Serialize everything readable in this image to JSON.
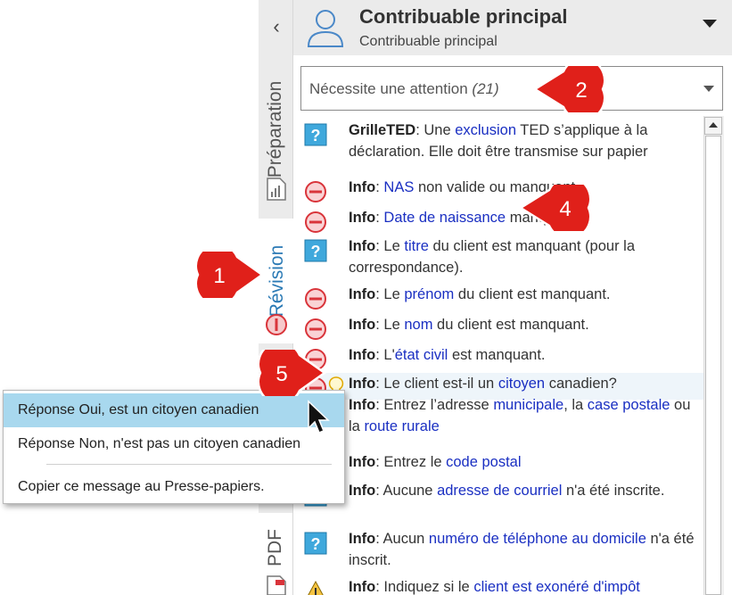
{
  "sidebar": {
    "collapse_glyph": "‹",
    "tabs": [
      {
        "label": "Préparation",
        "icon": "chart-doc-icon"
      },
      {
        "label": "Révision",
        "icon": "no-entry-icon",
        "active": true
      },
      {
        "label": "PDF",
        "icon": "pdf-doc-icon"
      }
    ]
  },
  "header": {
    "title": "Contribuable principal",
    "subtitle": "Contribuable principal",
    "icon": "user-icon"
  },
  "filter": {
    "label": "Nécessite une attention",
    "count": "(21)"
  },
  "messages": [
    {
      "icon": "question-icon",
      "parts": [
        {
          "t": "GrilleTED",
          "b": true
        },
        {
          "t": ": Une "
        },
        {
          "t": "exclusion",
          "l": true
        },
        {
          "t": " TED s’applique à la déclaration. Elle doit être transmise sur papier"
        }
      ]
    },
    {
      "icon": "no-entry-icon",
      "parts": [
        {
          "t": "Info",
          "b": true
        },
        {
          "t": ": "
        },
        {
          "t": "NAS",
          "l": true
        },
        {
          "t": " non valide ou manquant."
        }
      ]
    },
    {
      "icon": "no-entry-icon",
      "parts": [
        {
          "t": "Info",
          "b": true
        },
        {
          "t": ": "
        },
        {
          "t": "Date de naissance",
          "l": true
        },
        {
          "t": " manquante."
        }
      ]
    },
    {
      "icon": "question-icon",
      "parts": [
        {
          "t": "Info",
          "b": true
        },
        {
          "t": ": Le "
        },
        {
          "t": "titre",
          "l": true
        },
        {
          "t": " du client est manquant (pour la correspondance)."
        }
      ]
    },
    {
      "icon": "no-entry-icon",
      "parts": [
        {
          "t": "Info",
          "b": true
        },
        {
          "t": ": Le "
        },
        {
          "t": "prénom",
          "l": true
        },
        {
          "t": " du client est manquant."
        }
      ]
    },
    {
      "icon": "no-entry-icon",
      "parts": [
        {
          "t": "Info",
          "b": true
        },
        {
          "t": ": Le "
        },
        {
          "t": "nom",
          "l": true
        },
        {
          "t": " du client est manquant."
        }
      ]
    },
    {
      "icon": "no-entry-icon",
      "parts": [
        {
          "t": "Info",
          "b": true
        },
        {
          "t": ": L'"
        },
        {
          "t": "état civil",
          "l": true
        },
        {
          "t": " est manquant."
        }
      ]
    },
    {
      "icon": "no-entry-icon",
      "hint": "lightbulb-icon",
      "parts": [
        {
          "t": "Info",
          "b": true
        },
        {
          "t": ": Le client est-il un "
        },
        {
          "t": "citoyen",
          "l": true
        },
        {
          "t": " canadien?"
        }
      ]
    },
    {
      "icon": "question-icon",
      "parts": [
        {
          "t": "Info",
          "b": true
        },
        {
          "t": ": Entrez l’adresse "
        },
        {
          "t": "municipale",
          "l": true
        },
        {
          "t": ", la "
        },
        {
          "t": "case postale",
          "l": true
        },
        {
          "t": " ou la "
        },
        {
          "t": "route rurale",
          "l": true
        }
      ]
    },
    {
      "icon": "question-icon",
      "parts": [
        {
          "t": "Info",
          "b": true
        },
        {
          "t": ": Entrez le "
        },
        {
          "t": "code postal",
          "l": true
        }
      ]
    },
    {
      "icon": "question-icon",
      "parts": [
        {
          "t": "Info",
          "b": true
        },
        {
          "t": ": Aucune "
        },
        {
          "t": "adresse de courriel",
          "l": true
        },
        {
          "t": " n'a été inscrite."
        }
      ]
    },
    {
      "icon": "question-icon",
      "parts": [
        {
          "t": "Info",
          "b": true
        },
        {
          "t": ": Aucun "
        },
        {
          "t": "numéro de téléphone au domicile",
          "l": true
        },
        {
          "t": " n'a été inscrit."
        }
      ]
    },
    {
      "icon": "warning-icon",
      "parts": [
        {
          "t": "Info",
          "b": true
        },
        {
          "t": ": Indiquez si le "
        },
        {
          "t": "client est exonéré d'impôt",
          "l": true
        }
      ]
    }
  ],
  "context_menu": {
    "items": [
      {
        "label": "Réponse Oui, est un citoyen canadien",
        "active": true
      },
      {
        "label": "Réponse Non, n'est pas un citoyen canadien"
      },
      {
        "label": "Copier ce message au Presse-papiers."
      }
    ]
  },
  "callouts": [
    "1",
    "2",
    "4",
    "5"
  ],
  "colors": {
    "callout_red": "#e0201a",
    "link_blue": "#1a2fc2",
    "tab_active_blue": "#2b7ab5",
    "menu_highlight": "#a8d8ee",
    "question_fill": "#3fa8dc",
    "no_entry_red": "#d9343a"
  }
}
